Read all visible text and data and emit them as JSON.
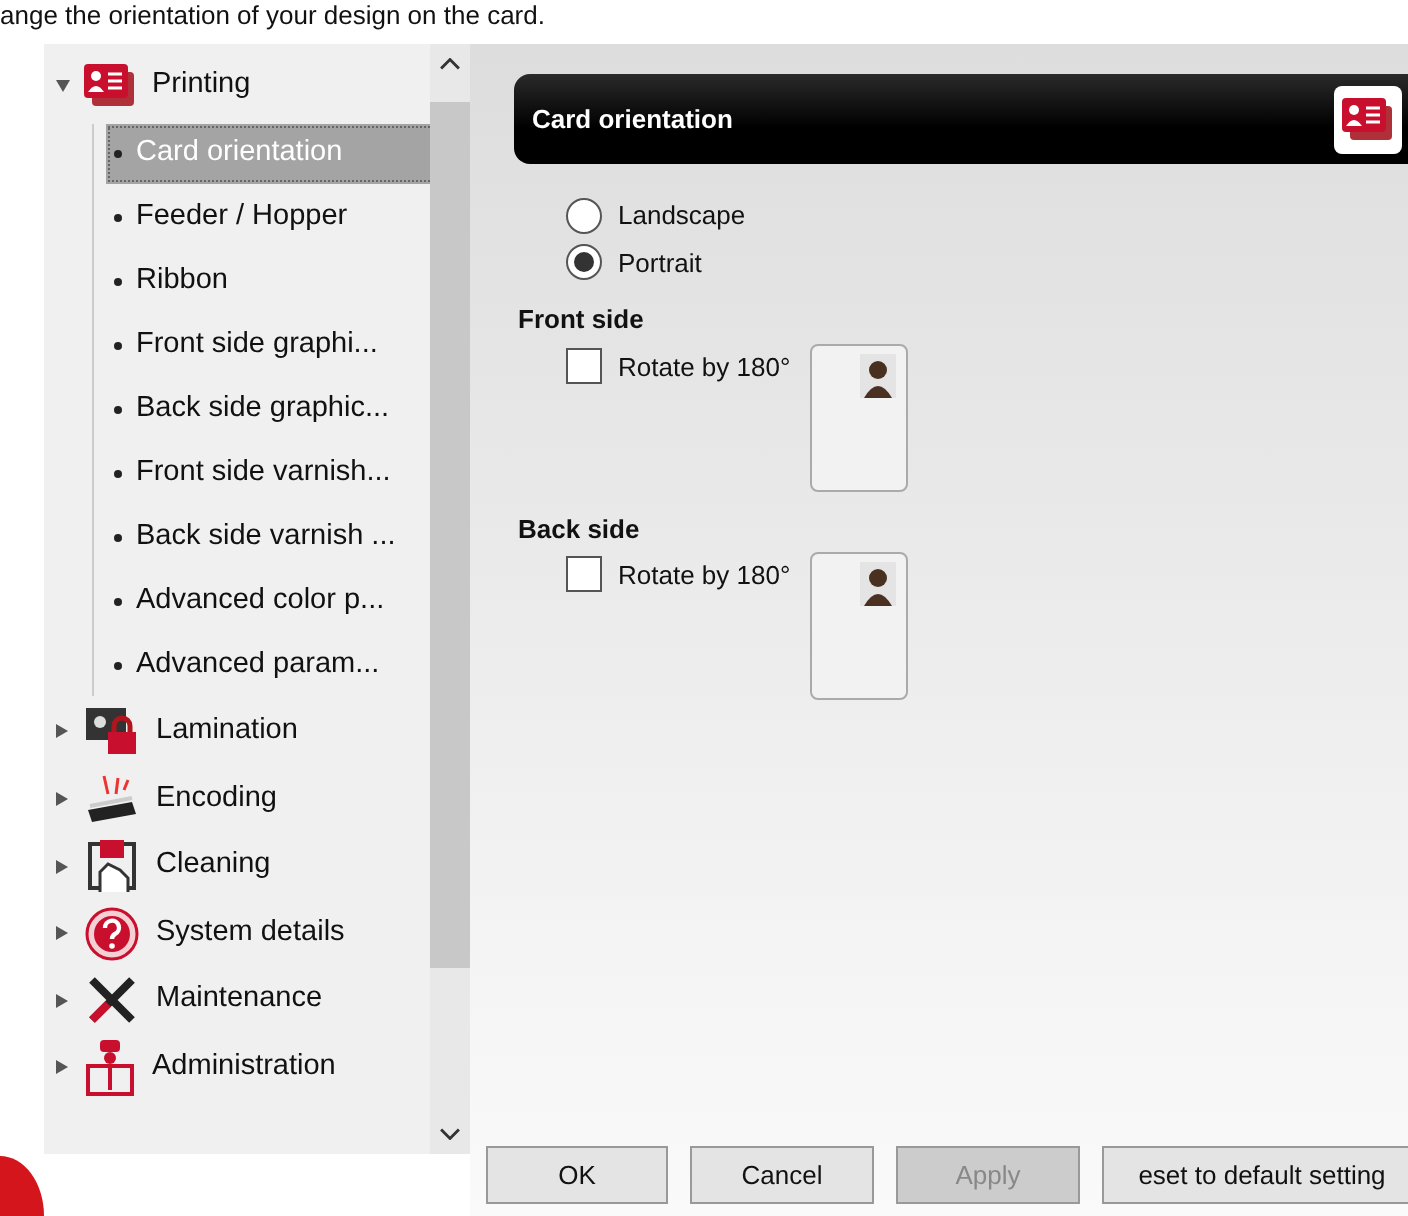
{
  "caption": "ange the orientation of your design on the card.",
  "tree": [
    {
      "label": "Printing",
      "expanded": true,
      "children": [
        {
          "label": "Card orientation",
          "selected": true
        },
        {
          "label": "Feeder / Hopper",
          "selected": false
        },
        {
          "label": "Ribbon",
          "selected": false
        },
        {
          "label": "Front side graphi...",
          "selected": false
        },
        {
          "label": "Back side graphic...",
          "selected": false
        },
        {
          "label": "Front side varnish...",
          "selected": false
        },
        {
          "label": "Back side varnish ...",
          "selected": false
        },
        {
          "label": "Advanced color p...",
          "selected": false
        },
        {
          "label": "Advanced param...",
          "selected": false
        }
      ]
    },
    {
      "label": "Lamination",
      "expanded": false
    },
    {
      "label": "Encoding",
      "expanded": false
    },
    {
      "label": "Cleaning",
      "expanded": false
    },
    {
      "label": "System details",
      "expanded": false
    },
    {
      "label": "Maintenance",
      "expanded": false
    },
    {
      "label": "Administration",
      "expanded": false
    }
  ],
  "panel": {
    "title": "Card orientation",
    "orientation": [
      {
        "label": "Landscape",
        "selected": false
      },
      {
        "label": "Portrait",
        "selected": true
      }
    ],
    "sides": [
      {
        "title": "Front side",
        "checkbox": "Rotate by 180°",
        "checked": false
      },
      {
        "title": "Back side",
        "checkbox": "Rotate by 180°",
        "checked": false
      }
    ]
  },
  "buttons": [
    {
      "label": "OK",
      "disabled": false
    },
    {
      "label": "Cancel",
      "disabled": false
    },
    {
      "label": "Apply",
      "disabled": true
    },
    {
      "label": "eset to default setting",
      "disabled": false
    }
  ]
}
